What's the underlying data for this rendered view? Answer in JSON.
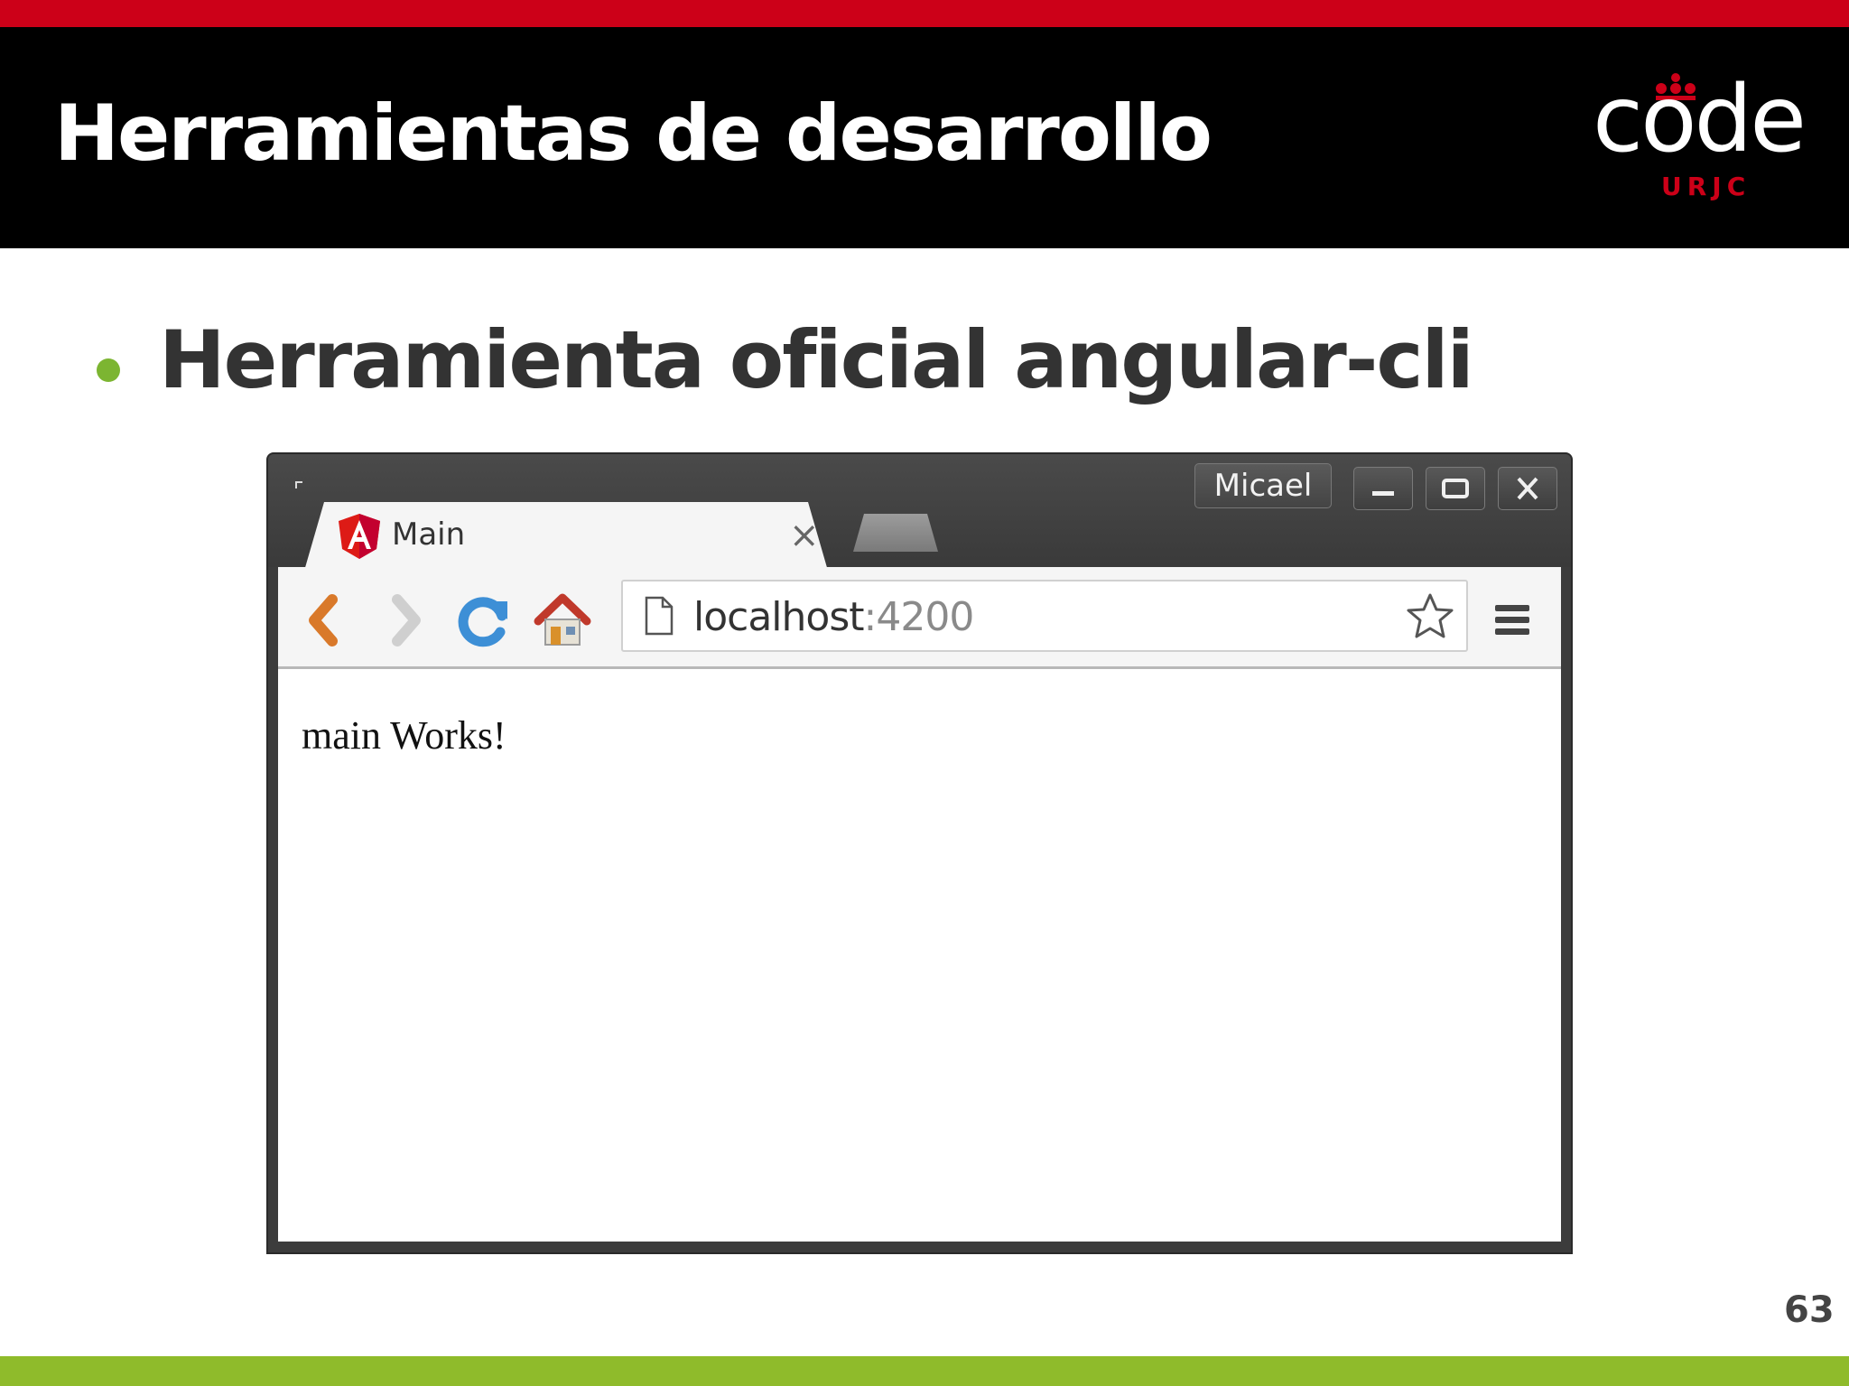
{
  "slide": {
    "title": "Herramientas de desarrollo",
    "bullet": "Herramienta oficial angular-cli",
    "page_number": "63",
    "logo": {
      "word": "code",
      "sub": "URJC"
    },
    "colors": {
      "top_bar": "#cc0018",
      "header": "#000000",
      "bullet": "#7cb531",
      "bottom_bar": "#8fbb2b"
    }
  },
  "browser": {
    "profile_name": "Micael",
    "tab": {
      "title": "Main",
      "icon": "angular-icon",
      "close": "×"
    },
    "address": {
      "host": "localhost",
      "port": ":4200"
    },
    "page_content": "main Works!",
    "icons": [
      "back-arrow-icon",
      "forward-arrow-icon",
      "reload-icon",
      "home-icon",
      "page-icon",
      "bookmark-star-icon",
      "menu-icon",
      "minimize-icon",
      "maximize-icon",
      "close-icon"
    ]
  }
}
